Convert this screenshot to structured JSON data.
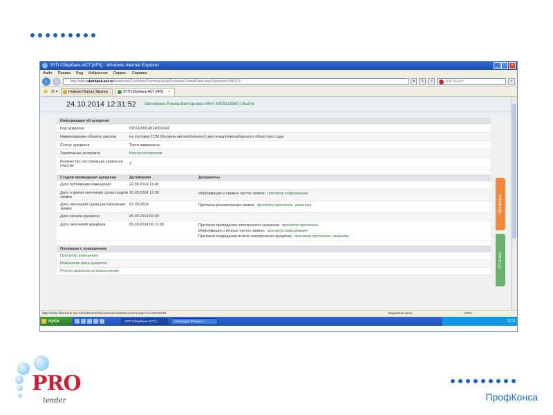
{
  "browser": {
    "window_title": "ЭТП Сбербанк-АСТ [#F5] - Windows Internet Explorer",
    "menu": [
      "Файл",
      "Правка",
      "Вид",
      "Избранное",
      "Сервис",
      "Справка"
    ],
    "url_prefix": "http://www.",
    "url_domain": "sberbank-ast.ru",
    "url_rest": "/tradezone/Customer/PurchaseView/PurchaseControlPanel.aspx?purchid=2083270",
    "search_placeholder": "Ask Search",
    "tabs": [
      {
        "label": "Главная Портал Закупок"
      },
      {
        "label": "ЭТП Сбербанк-АСТ [#F5]"
      }
    ],
    "status_url": "http://www.sberbank-ast.ru/tradezone/documents/viewDocument.aspx?id=24430438",
    "status_zone": "Надежные узлы",
    "status_zoom": "100%"
  },
  "page": {
    "datetime": "24.10.2014 12:31:52",
    "userline": "Шатовкина Римма Викторовна ИНН: 5406118840 | Выйти",
    "info_title": "Информация об аукционе",
    "info_rows": [
      {
        "k": "Код аукциона",
        "v": "0151100014914000043",
        "link": false
      },
      {
        "k": "Наименование объекта закупки",
        "v": "на поставку ГСМ (бензина автомобильного) для нужд Новосибирского областного суда",
        "link": false
      },
      {
        "k": "Статус аукциона",
        "v": "Торги завершены",
        "link": false
      },
      {
        "k": "Заключение контракта",
        "v": "Реестр контрактов",
        "link": true
      },
      {
        "k": "Количество поступивших заявок на участие",
        "v": "2",
        "link": false
      }
    ],
    "stages_headers": [
      "Стадия проведения аукциона",
      "Дата/время",
      "Документы"
    ],
    "stages": [
      {
        "stage": "Дата публикации извещения",
        "date": "22.08.2014 11:48",
        "docs": ""
      },
      {
        "stage": "Дата и время окончания срока подачи заявок",
        "date": "30.08.2014 12:00",
        "docs": "Информация о первых частях заявок:",
        "link1": "просмотр информации",
        "link2": ""
      },
      {
        "stage": "Дата окончания срока рассмотрения заявок",
        "date": "02.09.2014",
        "docs": "Протокол рассмотрения заявок:",
        "link1": "просмотр протокола",
        "link2": "изменить"
      },
      {
        "stage": "Дата начала аукциона",
        "date": "05.09.2014 06:00",
        "docs": ""
      },
      {
        "stage": "Дата окончания аукциона",
        "date": "05.09.2014 06:11:06",
        "docs_lines": [
          {
            "text": "Протокол проведения электронного аукциона:",
            "link1": "просмотр протокола",
            "link2": ""
          },
          {
            "text": "Информация о вторых частях заявок:",
            "link1": "просмотр информации",
            "link2": ""
          },
          {
            "text": "Протокол подведения итогов электронного аукциона:",
            "link1": "просмотр протокола",
            "link2": "изменить"
          }
        ]
      }
    ],
    "ops_title": "Операции с извещением",
    "ops": [
      "Просмотр извещения",
      "Изменение шага аукциона",
      "Реестр запросов на разъяснение"
    ],
    "side_tabs": [
      "Вопросы",
      "Отзывы"
    ]
  },
  "taskbar": {
    "start": "пуск",
    "items": [
      "ЭТП Сбербанк-АСТ [...",
      "площадка [Режим с..."
    ],
    "clock": "13:31"
  },
  "branding": {
    "logo_main": "PRO",
    "logo_sub": "tender",
    "company": "ПрофКонса"
  }
}
